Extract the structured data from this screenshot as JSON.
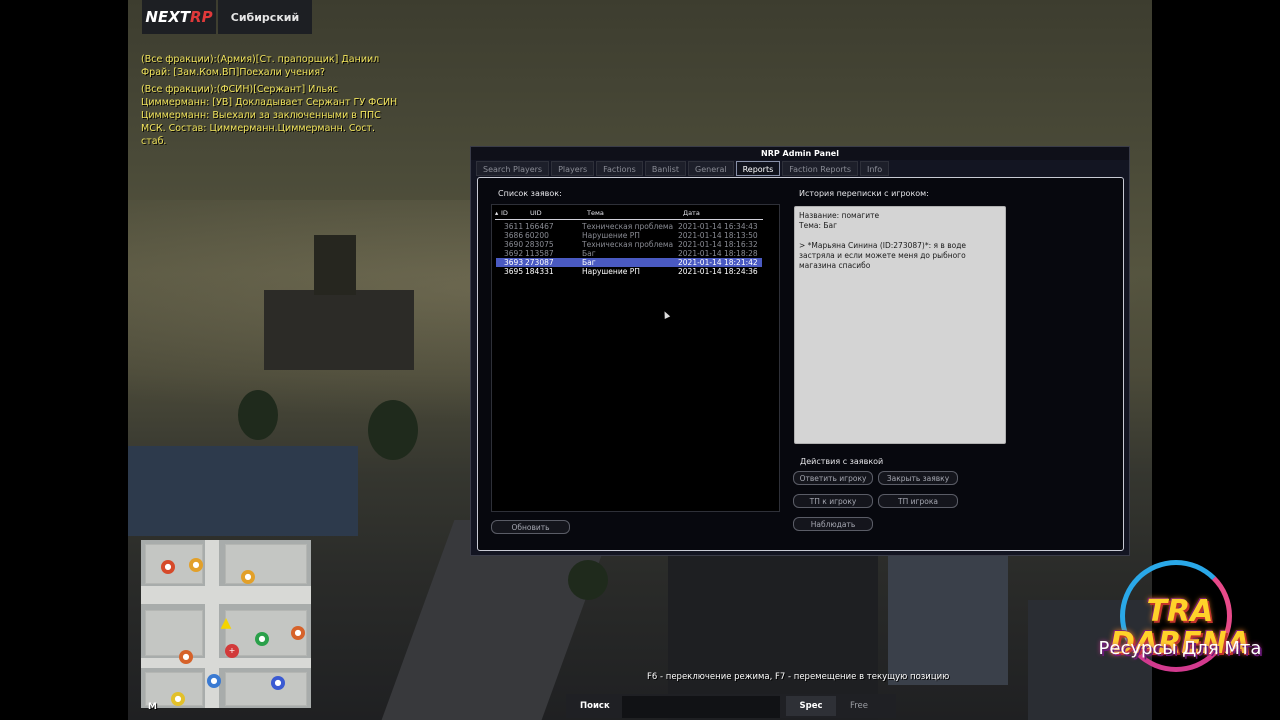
{
  "hud": {
    "logo": {
      "prefix": "NEXT",
      "suffix": "RP"
    },
    "server_name": "Сибирский"
  },
  "chat": [
    "(Все фракции):(Армия)[Ст. прапорщик] Даниил Фрай: [Зам.Ком.ВП]Поехали учения?",
    "(Все фракции):(ФСИН)[Сержант] Ильяс Циммерманн: [УВ] Докладывает Сержант ГУ ФСИН Циммерманн: Выехали за заключенными в ППС МСК. Состав: Циммерманн.Циммерманн. Сост. стаб."
  ],
  "panel": {
    "title": "NRP Admin Panel",
    "tabs": [
      "Search Players",
      "Players",
      "Factions",
      "Banlist",
      "General",
      "Reports",
      "Faction Reports",
      "Info"
    ],
    "active_tab": "Reports",
    "requests_label": "Список заявок:",
    "columns": {
      "id": "ID",
      "uid": "UID",
      "topic": "Тема",
      "date": "Дата"
    },
    "rows": [
      {
        "id": "3611",
        "uid": "166467",
        "topic": "Техническая проблема",
        "date": "2021-01-14 16:34:43",
        "state": "faded"
      },
      {
        "id": "3686",
        "uid": "60200",
        "topic": "Нарушение РП",
        "date": "2021-01-14 18:13:50",
        "state": "faded"
      },
      {
        "id": "3690",
        "uid": "283075",
        "topic": "Техническая проблема",
        "date": "2021-01-14 18:16:32",
        "state": "faded"
      },
      {
        "id": "3692",
        "uid": "113587",
        "topic": "Баг",
        "date": "2021-01-14 18:18:28",
        "state": "faded"
      },
      {
        "id": "3693",
        "uid": "273087",
        "topic": "Баг",
        "date": "2021-01-14 18:21:42",
        "state": "selected"
      },
      {
        "id": "3695",
        "uid": "184331",
        "topic": "Нарушение РП",
        "date": "2021-01-14 18:24:36",
        "state": "normal"
      }
    ],
    "refresh_button": "Обновить",
    "history_label": "История переписки с игроком:",
    "history": {
      "name_line": "Название: помагите",
      "topic_line": "Тема: Баг",
      "message": "> *Марьяна Синина (ID:273087)*: я в воде застряла и если можете меня до рыбного магазина спасибо"
    },
    "actions_label": "Действия с заявкой",
    "actions": {
      "reply": "Ответить игроку",
      "close": "Закрыть заявку",
      "tp_to": "ТП к игроку",
      "tp_player": "ТП игрока",
      "watch": "Наблюдать"
    }
  },
  "minimap": {
    "north_label": "M"
  },
  "hint": "F6 - переключение режима, F7 - перемещение в текущую позицию",
  "bottom_bar": {
    "search_label": "Поиск",
    "search_placeholder": "",
    "spec_label": "Spec",
    "free_label": "Free"
  },
  "watermark": {
    "title": "TRA DARENA",
    "subtitle": "Ресурсы Для Мта"
  },
  "colors": {
    "chat_text": "#f0e35c",
    "selected_row": "#4a5ac2",
    "logo_accent": "#e0393a"
  }
}
